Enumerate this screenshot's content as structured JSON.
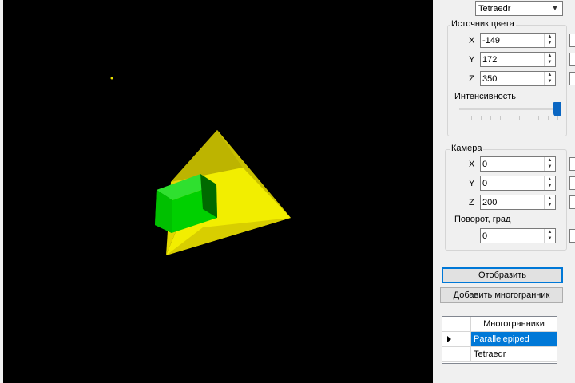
{
  "scene": {
    "background": "#000000",
    "objects": [
      {
        "name": "Tetraedr",
        "color": "#e8e000"
      },
      {
        "name": "Parallelepiped",
        "color": "#00cc00"
      }
    ]
  },
  "shape_combo": {
    "value": "Tetraedr"
  },
  "light_source": {
    "legend": "Источник цвета",
    "x_label": "X",
    "x_value": "-149",
    "y_label": "Y",
    "y_value": "172",
    "z_label": "Z",
    "z_value": "350",
    "intensity_label": "Интенсивность",
    "intensity_level": 1.0
  },
  "camera": {
    "legend": "Камера",
    "x_label": "X",
    "x_value": "0",
    "y_label": "Y",
    "y_value": "0",
    "z_label": "Z",
    "z_value": "200",
    "rotation_label": "Поворот, град",
    "rotation_value": "0"
  },
  "buttons": {
    "render_label": "Отобразить",
    "add_polyhedron_label": "Добавить многогранник"
  },
  "polyhedra_grid": {
    "header": "Многогранники",
    "rows": [
      "Parallelepiped",
      "Tetraedr"
    ],
    "selected_index": 0
  },
  "colors": {
    "accent": "#0078d7",
    "panel": "#f0f0f0"
  },
  "icons": {
    "combo_arrow": "chevron-down-icon",
    "spin_up": "caret-up-icon",
    "spin_down": "caret-down-icon",
    "row_marker": "row-pointer-icon"
  }
}
